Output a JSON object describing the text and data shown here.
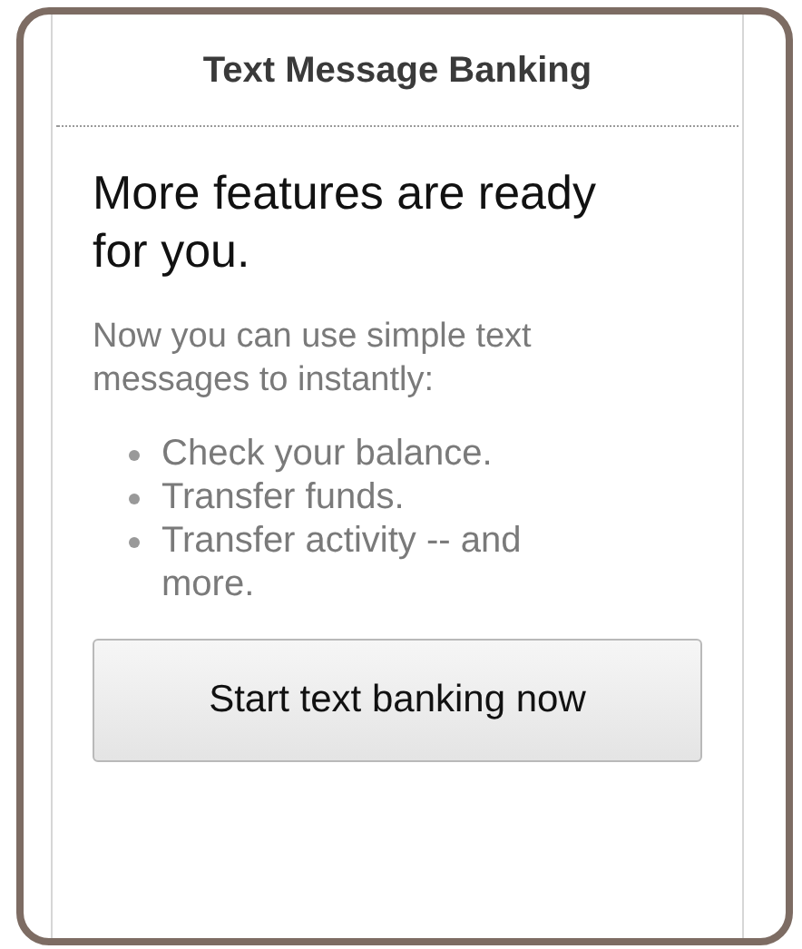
{
  "header": {
    "title": "Text Message Banking"
  },
  "promo": {
    "heading": "More features are ready for you.",
    "intro": "Now you can use simple text messages to instantly:",
    "features": [
      "Check your balance.",
      "Transfer funds.",
      "Transfer activity -- and more."
    ],
    "button": "Start text banking now"
  }
}
